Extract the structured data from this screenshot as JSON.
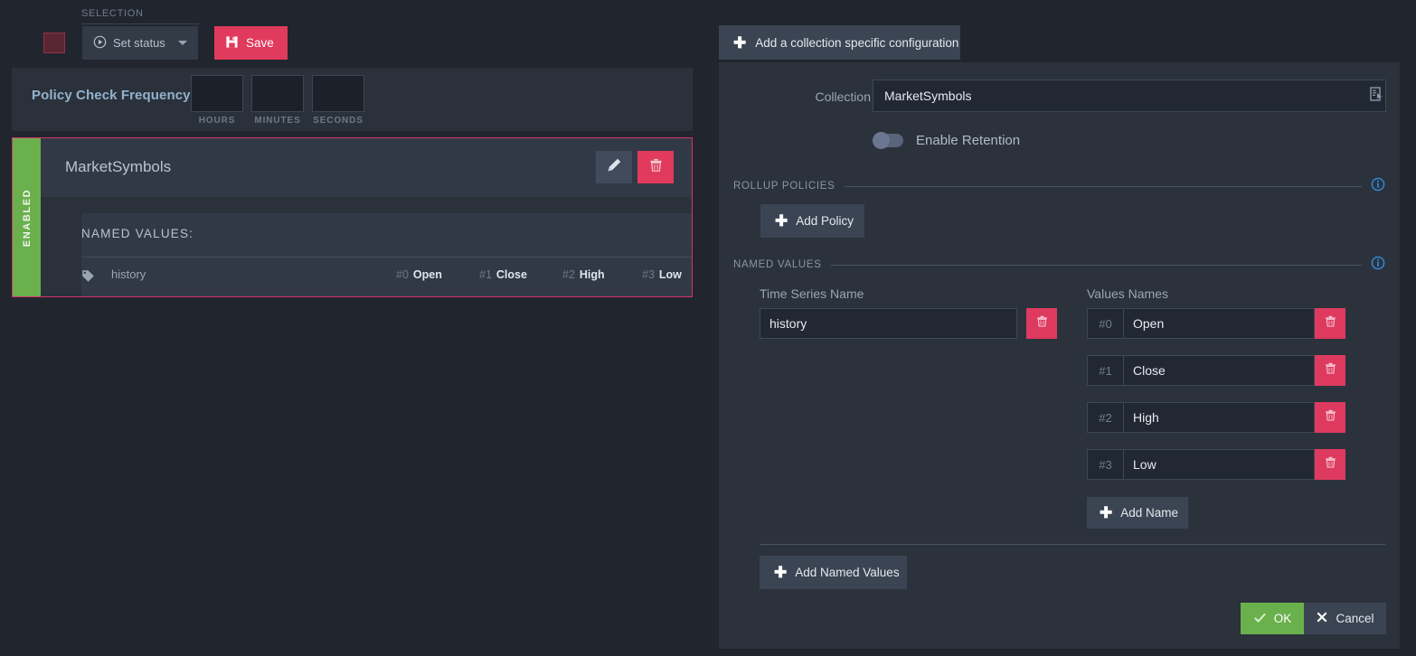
{
  "toolbar": {
    "selection_label": "SELECTION",
    "status_swatch": "status-color-swatch",
    "set_status_label": "Set status",
    "save_label": "Save",
    "accent_red": "#e03a5c"
  },
  "frequency": {
    "title": "Policy Check Frequency",
    "fields": [
      {
        "caption": "HOURS",
        "value": ""
      },
      {
        "caption": "MINUTES",
        "value": ""
      },
      {
        "caption": "SECONDS",
        "value": ""
      }
    ]
  },
  "collection_card": {
    "status_strip": "ENABLED",
    "title": "MarketSymbols",
    "named_values_title": "NAMED VALUES:",
    "series_name": "history",
    "values": [
      {
        "index": "#0",
        "name": "Open"
      },
      {
        "index": "#1",
        "name": "Close"
      },
      {
        "index": "#2",
        "name": "High"
      },
      {
        "index": "#3",
        "name": "Low"
      }
    ],
    "border_color": "#d8326b",
    "enabled_color": "#6ab04c"
  },
  "panel": {
    "add_config_label": "Add a collection specific configuration",
    "collection_label": "Collection",
    "collection_value": "MarketSymbols",
    "collection_placeholder": "Collection name",
    "retention_label": "Enable Retention",
    "retention_enabled": false,
    "rollup_section": "ROLLUP POLICIES",
    "add_policy_label": "Add Policy",
    "named_values_section": "NAMED VALUES",
    "time_series_header": "Time Series Name",
    "values_names_header": "Values Names",
    "time_series_value": "history",
    "time_series_placeholder": "Time series name",
    "values": [
      {
        "index": "#0",
        "value": "Open",
        "placeholder": "Value name"
      },
      {
        "index": "#1",
        "value": "Close",
        "placeholder": "Value name"
      },
      {
        "index": "#2",
        "value": "High",
        "placeholder": "Value name"
      },
      {
        "index": "#3",
        "value": "Low",
        "placeholder": "Value name"
      }
    ],
    "add_name_label": "Add Name",
    "add_named_values_label": "Add Named Values",
    "ok_label": "OK",
    "cancel_label": "Cancel",
    "info_color": "#2f8fe0",
    "ok_color": "#6ab04c"
  }
}
